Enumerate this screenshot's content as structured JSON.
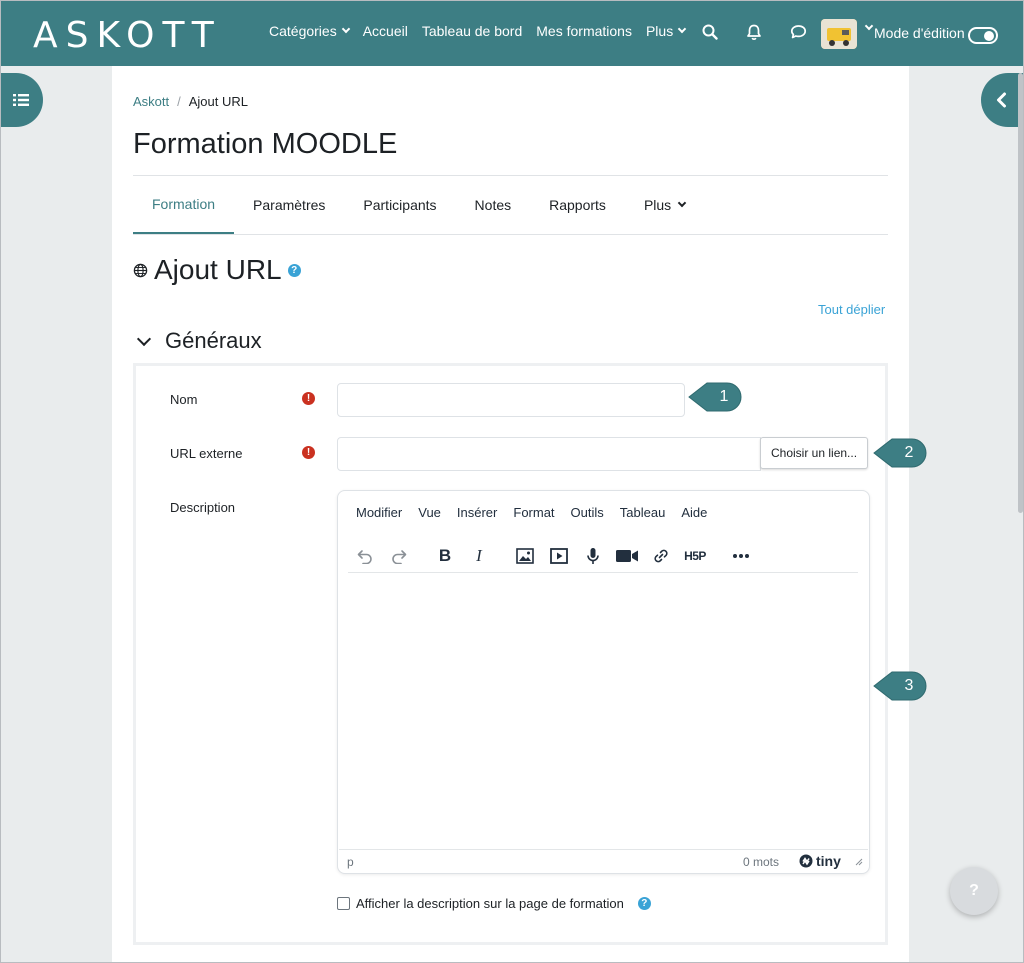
{
  "brand": {
    "logo": "ASKOTT",
    "accent": "#3d7e84"
  },
  "navbar": {
    "links": [
      {
        "label": "Catégories",
        "dropdown": true
      },
      {
        "label": "Accueil",
        "dropdown": false
      },
      {
        "label": "Tableau de bord",
        "dropdown": false
      },
      {
        "label": "Mes formations",
        "dropdown": false
      },
      {
        "label": "Plus",
        "dropdown": true
      }
    ],
    "icons": [
      "search-icon",
      "bell-icon",
      "chat-icon"
    ],
    "edit_mode_label": "Mode d'édition"
  },
  "breadcrumb": {
    "root": "Askott",
    "separator": "/",
    "current": "Ajout URL"
  },
  "page": {
    "title": "Formation MOODLE"
  },
  "tabs": [
    {
      "label": "Formation",
      "active": true
    },
    {
      "label": "Paramètres",
      "active": false
    },
    {
      "label": "Participants",
      "active": false
    },
    {
      "label": "Notes",
      "active": false
    },
    {
      "label": "Rapports",
      "active": false
    },
    {
      "label": "Plus",
      "active": false,
      "dropdown": true
    }
  ],
  "activity": {
    "title": "Ajout URL",
    "help": "?",
    "expand_all": "Tout déplier"
  },
  "section": {
    "title": "Généraux"
  },
  "form": {
    "name_label": "Nom",
    "name_value": "",
    "url_label": "URL externe",
    "url_value": "",
    "choose_link_button": "Choisir un lien...",
    "description_label": "Description",
    "required_marker": "!",
    "show_description_label": "Afficher la description sur la page de formation"
  },
  "editor": {
    "menu": [
      "Modifier",
      "Vue",
      "Insérer",
      "Format",
      "Outils",
      "Tableau",
      "Aide"
    ],
    "toolbar": [
      "undo-icon",
      "redo-icon",
      "bold-icon",
      "italic-icon",
      "image-icon",
      "media-icon",
      "microphone-icon",
      "video-camera-icon",
      "link-icon",
      "h5p-icon",
      "more-icon"
    ],
    "status_path": "p",
    "word_count": "0 mots",
    "brand": "tiny"
  },
  "callouts": [
    "1",
    "2",
    "3"
  ],
  "floating_help": "?"
}
